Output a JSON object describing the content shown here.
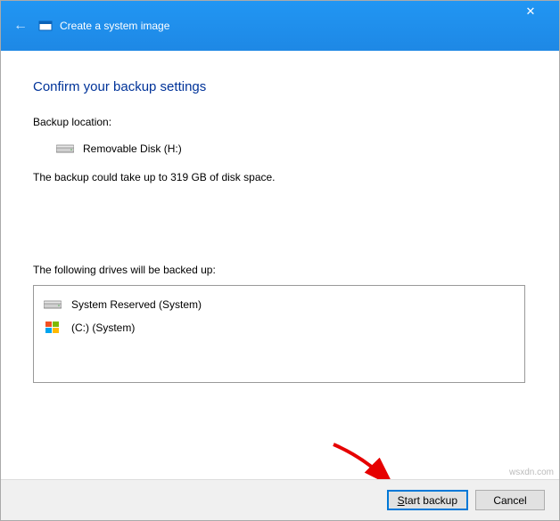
{
  "titlebar": {
    "title": "Create a system image"
  },
  "page": {
    "heading": "Confirm your backup settings",
    "location_label": "Backup location:",
    "location_value": "Removable Disk (H:)",
    "size_text": "The backup could take up to 319 GB of disk space.",
    "drives_label": "The following drives will be backed up:",
    "drives": [
      {
        "label": "System Reserved (System)"
      },
      {
        "label": "(C:) (System)"
      }
    ]
  },
  "footer": {
    "start_label": "Start backup",
    "cancel_label": "Cancel"
  },
  "watermark": "wsxdn.com"
}
